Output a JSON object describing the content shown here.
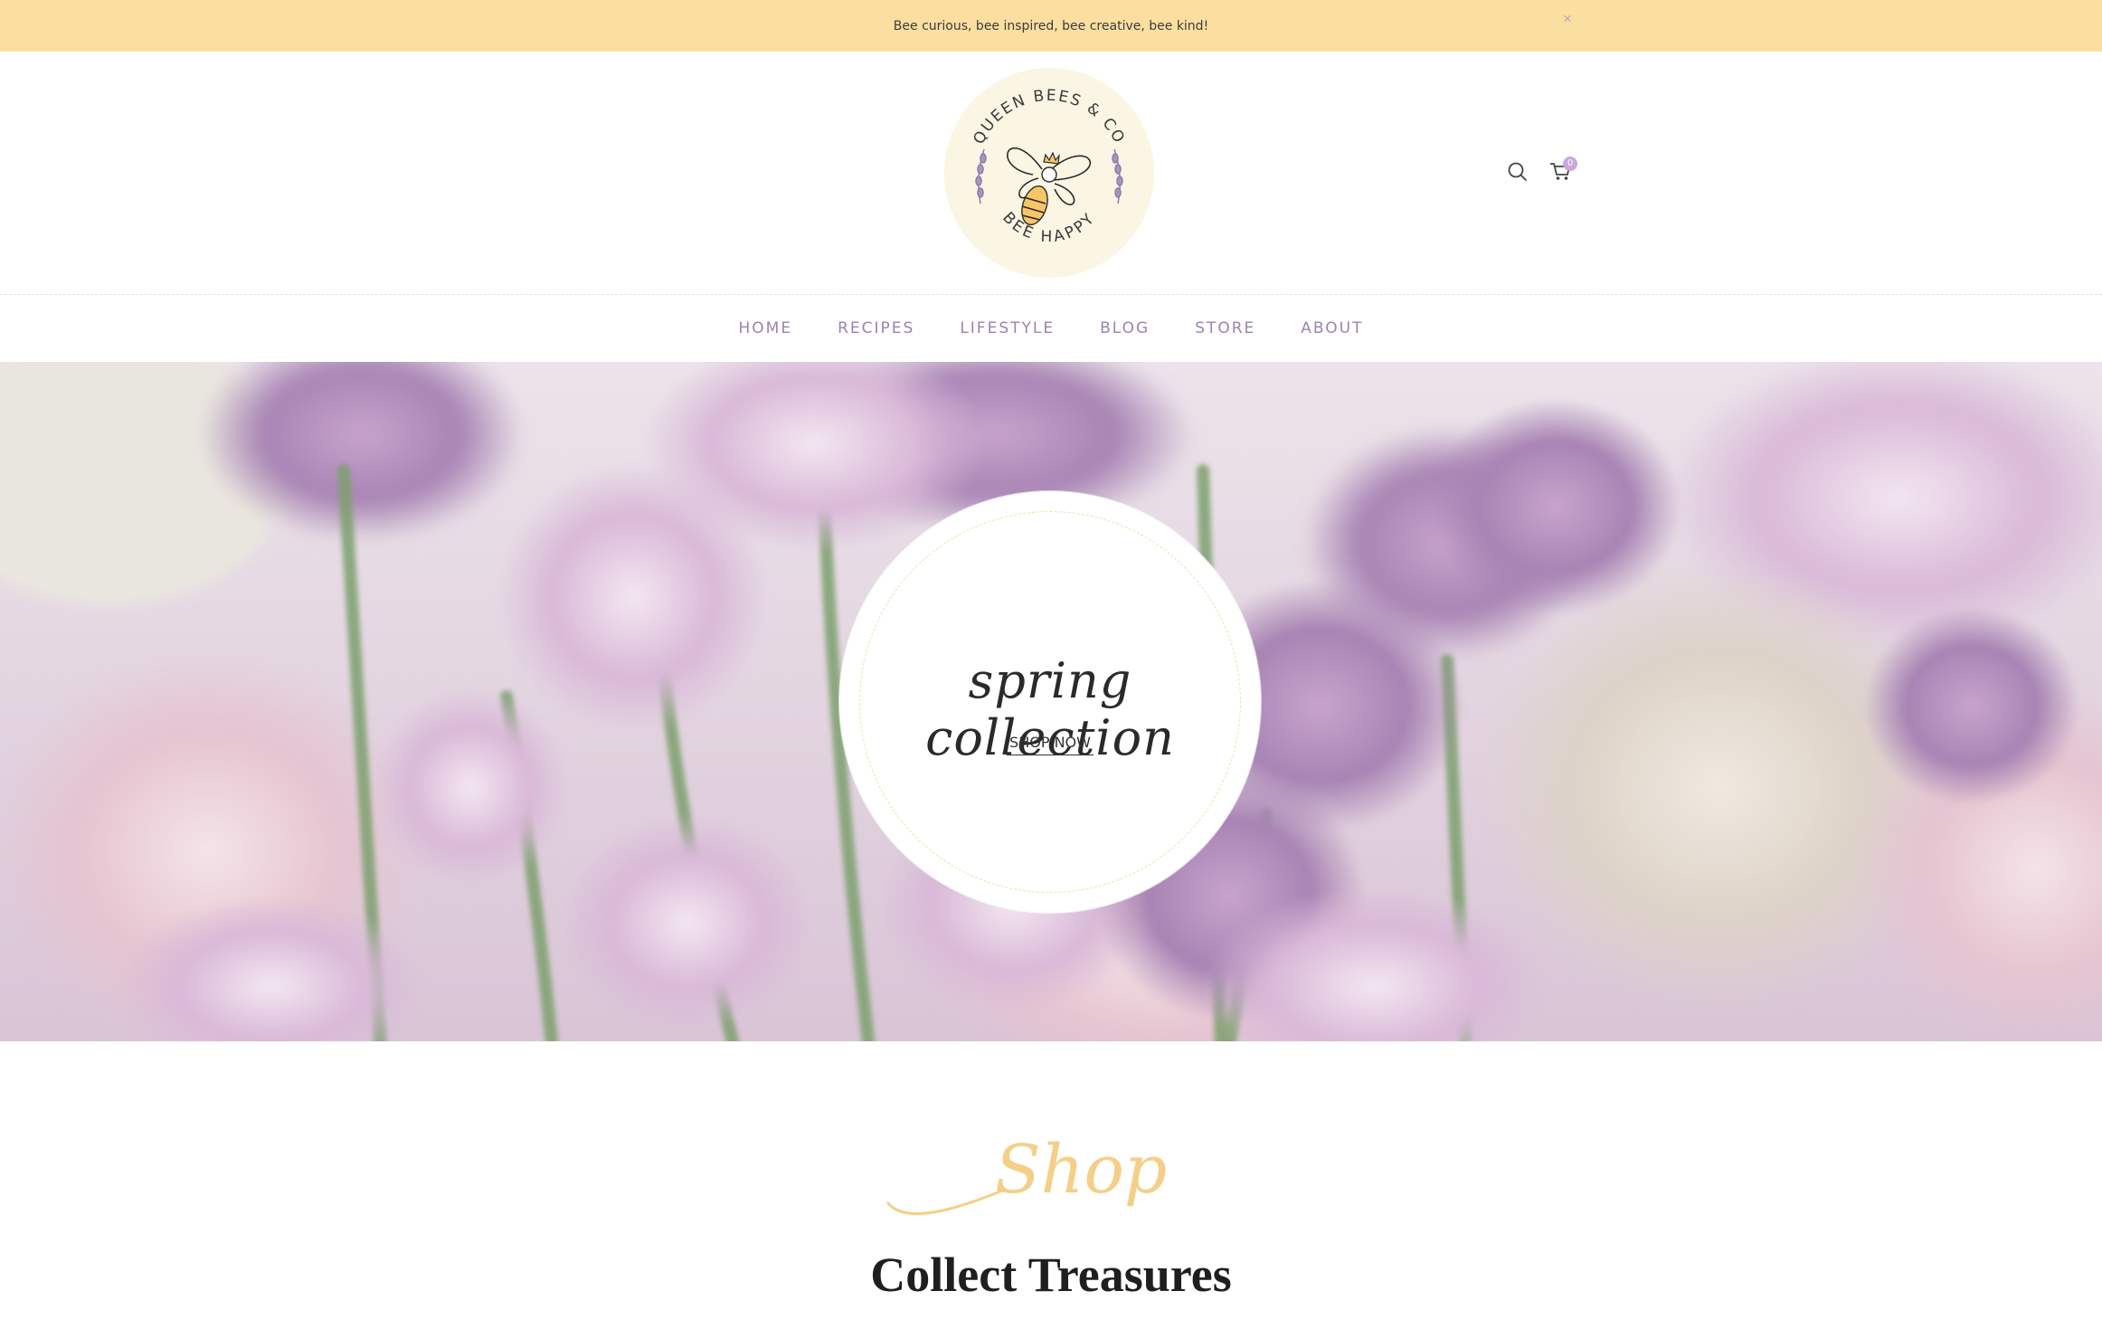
{
  "announcement": {
    "text": "Bee curious, bee inspired, bee creative, bee kind!",
    "close_label": "×"
  },
  "logo": {
    "top_text": "QUEEN BEES & CO",
    "bottom_text": "BEE HAPPY"
  },
  "header": {
    "search_icon": "search-icon",
    "cart_icon": "cart-icon",
    "cart_count": "0"
  },
  "nav": {
    "items": [
      {
        "label": "HOME"
      },
      {
        "label": "RECIPES"
      },
      {
        "label": "LIFESTYLE"
      },
      {
        "label": "BLOG"
      },
      {
        "label": "STORE"
      },
      {
        "label": "ABOUT"
      }
    ]
  },
  "hero": {
    "title": "spring collection",
    "cta": "SHOP NOW"
  },
  "shop_section": {
    "script_label": "Shop",
    "title": "Collect Treasures"
  },
  "colors": {
    "announcement_bg": "#fbdfa0",
    "nav_text": "#9c82b3",
    "accent_gold": "#f5cf88",
    "cart_badge": "#c9a8dd"
  }
}
